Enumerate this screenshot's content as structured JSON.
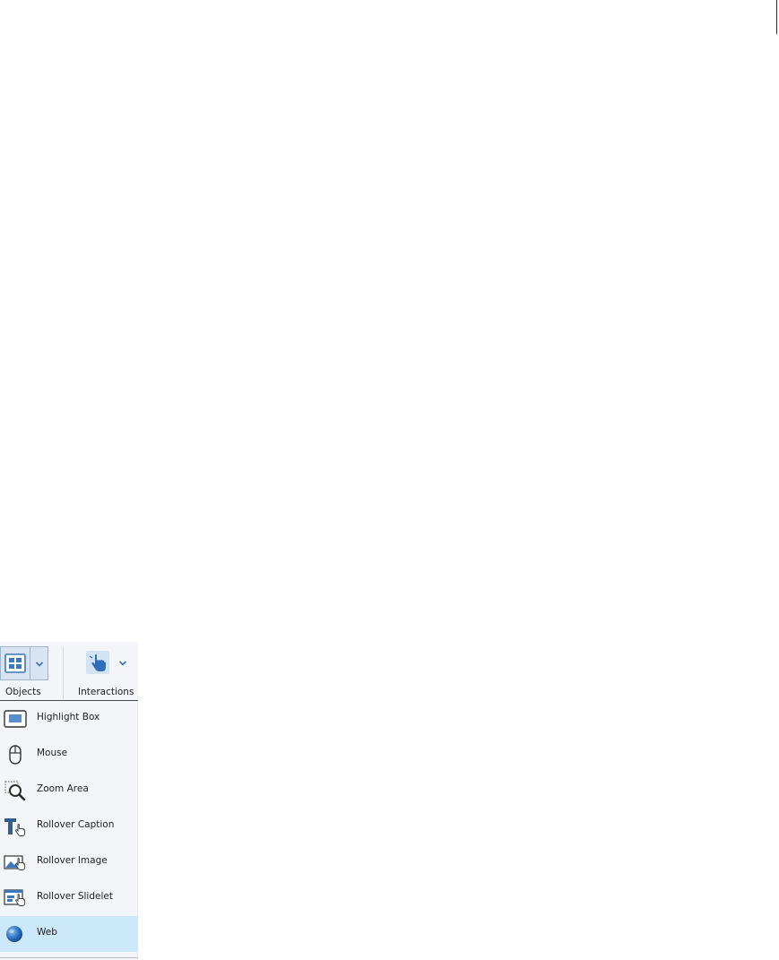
{
  "toolbar": {
    "objects_label": "Objects",
    "interactions_label": "Interactions",
    "objects_icon": "objects-grid-icon",
    "interactions_icon": "hand-pointer-icon"
  },
  "menu": {
    "items": [
      {
        "label": "Highlight Box",
        "icon": "highlight-box-icon"
      },
      {
        "label": "Mouse",
        "icon": "mouse-icon"
      },
      {
        "label": "Zoom Area",
        "icon": "zoom-area-icon"
      },
      {
        "label": "Rollover Caption",
        "icon": "rollover-caption-icon"
      },
      {
        "label": "Rollover Image",
        "icon": "rollover-image-icon"
      },
      {
        "label": "Rollover Slidelet",
        "icon": "rollover-slidelet-icon"
      },
      {
        "label": "Web",
        "icon": "web-globe-icon"
      }
    ],
    "selected": "Web"
  },
  "colors": {
    "accent": "#3b78c2",
    "selected_bg": "#cce8fb",
    "panel_bg": "#f3f5f8"
  }
}
